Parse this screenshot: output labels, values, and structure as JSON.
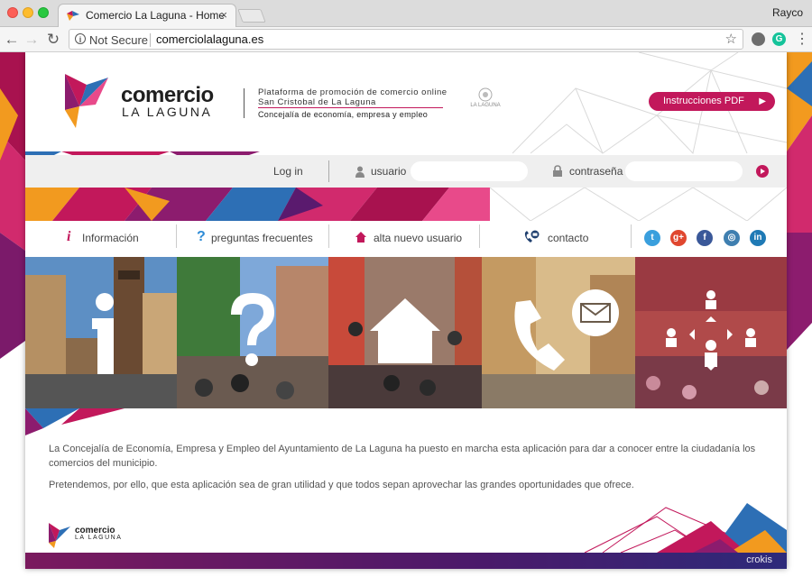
{
  "browser": {
    "tab_title": "Comercio La Laguna - Home",
    "tab_close": "×",
    "profile_name": "Rayco",
    "security_label": "Not Secure",
    "url": "comerciolalaguna.es",
    "nav_back": "←",
    "nav_forward": "→",
    "nav_reload": "↻",
    "star": "☆",
    "menu": "⋮",
    "ext_grammarly": "G",
    "info_glyph": "i"
  },
  "header": {
    "logo_word1": "comercio",
    "logo_word2": "LA LAGUNA",
    "tagline": "Plataforma de promoción de comercio online",
    "subtitle": "San Cristobal de La Laguna",
    "department": "Concejalía de economía, empresa y empleo",
    "seal_text": "LA LAGUNA",
    "pdf_button": "Instrucciones PDF",
    "pdf_arrow": "▶"
  },
  "login": {
    "label": "Log in",
    "user_label": "usuario",
    "pass_label": "contraseña",
    "user_value": "",
    "pass_value": ""
  },
  "menu": {
    "items": [
      {
        "label": "Información",
        "icon": "info-icon",
        "glyph": "i"
      },
      {
        "label": "preguntas frecuentes",
        "icon": "question-icon",
        "glyph": "?"
      },
      {
        "label": "alta nuevo usuario",
        "icon": "home-icon",
        "glyph": ""
      },
      {
        "label": "contacto",
        "icon": "phone-mail-icon",
        "glyph": ""
      }
    ],
    "social": [
      {
        "name": "twitter",
        "glyph": "t",
        "color": "#3a9fdd"
      },
      {
        "name": "google-plus",
        "glyph": "g+",
        "color": "#e0472f"
      },
      {
        "name": "facebook",
        "glyph": "f",
        "color": "#3a5899"
      },
      {
        "name": "instagram",
        "glyph": "◎",
        "color": "#3f7fb0"
      },
      {
        "name": "linkedin",
        "glyph": "in",
        "color": "#1f7ab5"
      }
    ]
  },
  "photos": [
    {
      "name": "info-tile",
      "icon": "info-icon"
    },
    {
      "name": "faq-tile",
      "icon": "question-icon"
    },
    {
      "name": "register-tile",
      "icon": "home-icon"
    },
    {
      "name": "contact-tile",
      "icon": "phone-mail-icon"
    },
    {
      "name": "network-tile",
      "icon": "network-icon"
    }
  ],
  "intro": {
    "paragraph1": "La Concejalía de Economía, Empresa y Empleo del Ayuntamiento de La Laguna ha puesto en marcha esta aplicación para dar a conocer entre la ciudadanía los comercios del municipio.",
    "paragraph2": "Pretendemos, por ello, que esta aplicación sea de gran utilidad y que todos sepan aprovechar las grandes oportunidades que ofrece."
  },
  "footer": {
    "logo_word1": "comercio",
    "logo_word2": "LA LAGUNA",
    "credit": "crokis"
  },
  "colors": {
    "brand": "#c2185b",
    "accent_blue": "#2d6fb5",
    "orange": "#f29a1f",
    "purple": "#5a1a6e"
  }
}
